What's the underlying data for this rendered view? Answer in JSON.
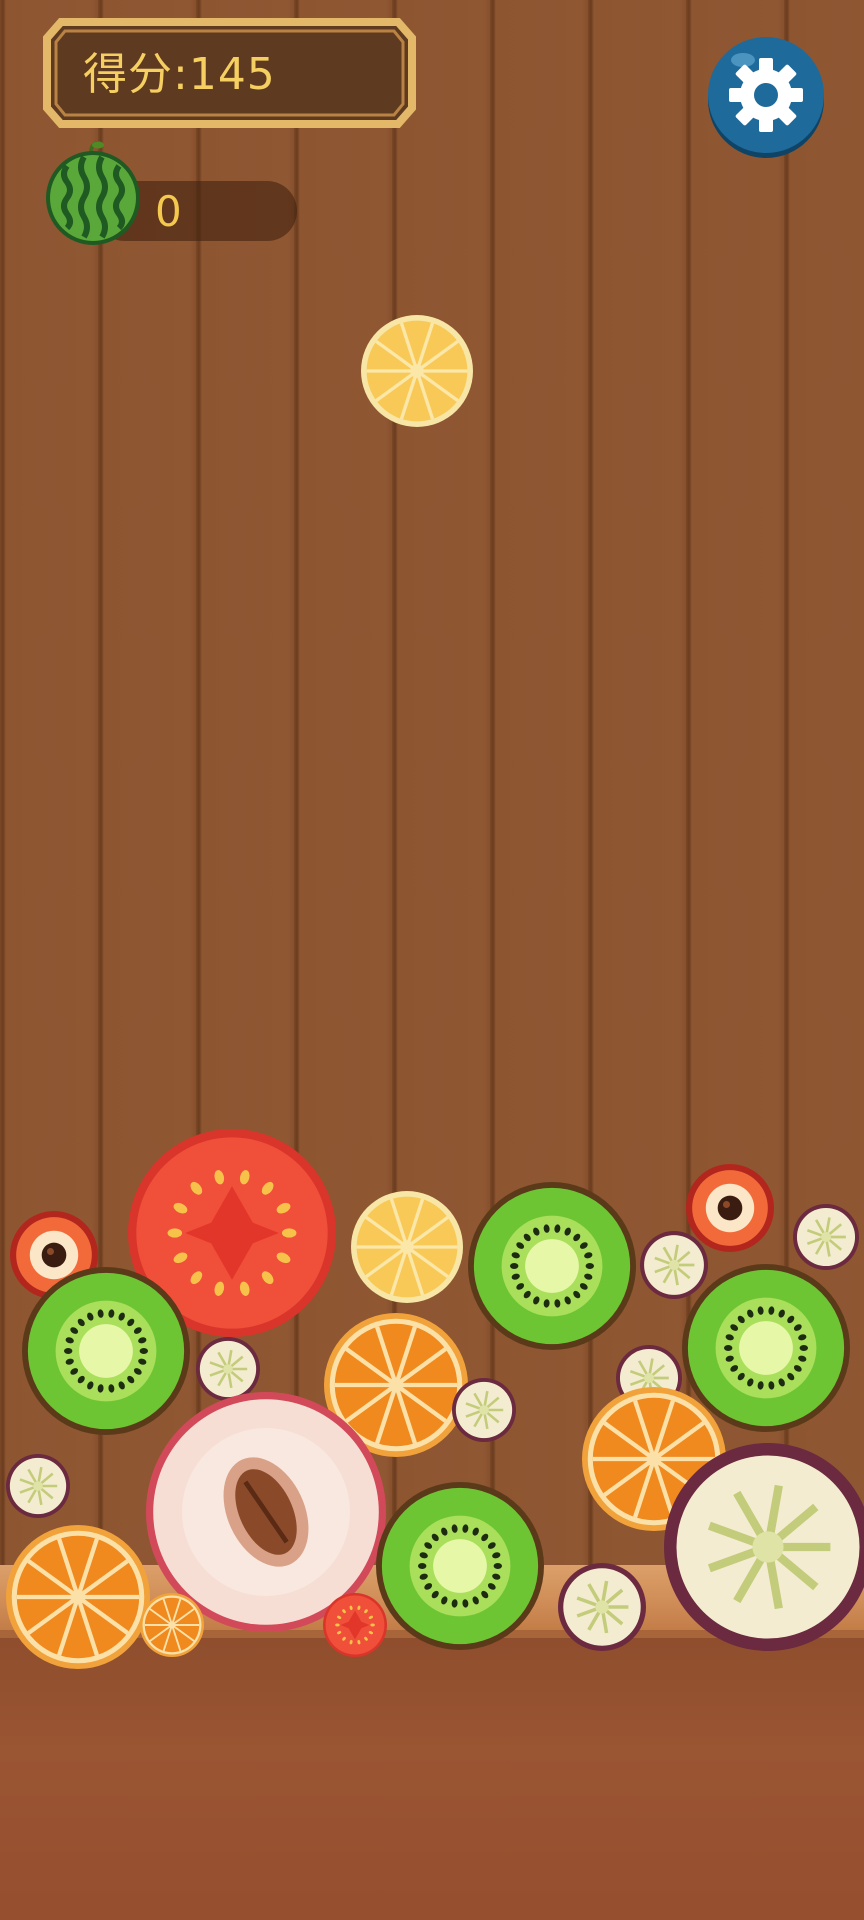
{
  "hud": {
    "score_text": "得分:145",
    "watermelon_count": "0"
  },
  "icons": {
    "settings": "gear-icon",
    "watermelon": "watermelon-icon"
  },
  "colors": {
    "score_text": "#f6cf62",
    "panel_frame": "#d9a85a",
    "gear_button": "#1e6a9b"
  },
  "board": {
    "next_fruit": "lemon",
    "fruits": [
      "lychee",
      "tomato",
      "lemon",
      "kiwi",
      "lychee",
      "passionfruit",
      "passionfruit",
      "kiwi",
      "orange",
      "passionfruit",
      "kiwi",
      "passionfruit",
      "passionfruit",
      "peach",
      "orange",
      "passionfruit",
      "orange",
      "kiwi",
      "orange",
      "tomato",
      "passionfruit",
      "passionfruit",
      "lychee"
    ]
  }
}
